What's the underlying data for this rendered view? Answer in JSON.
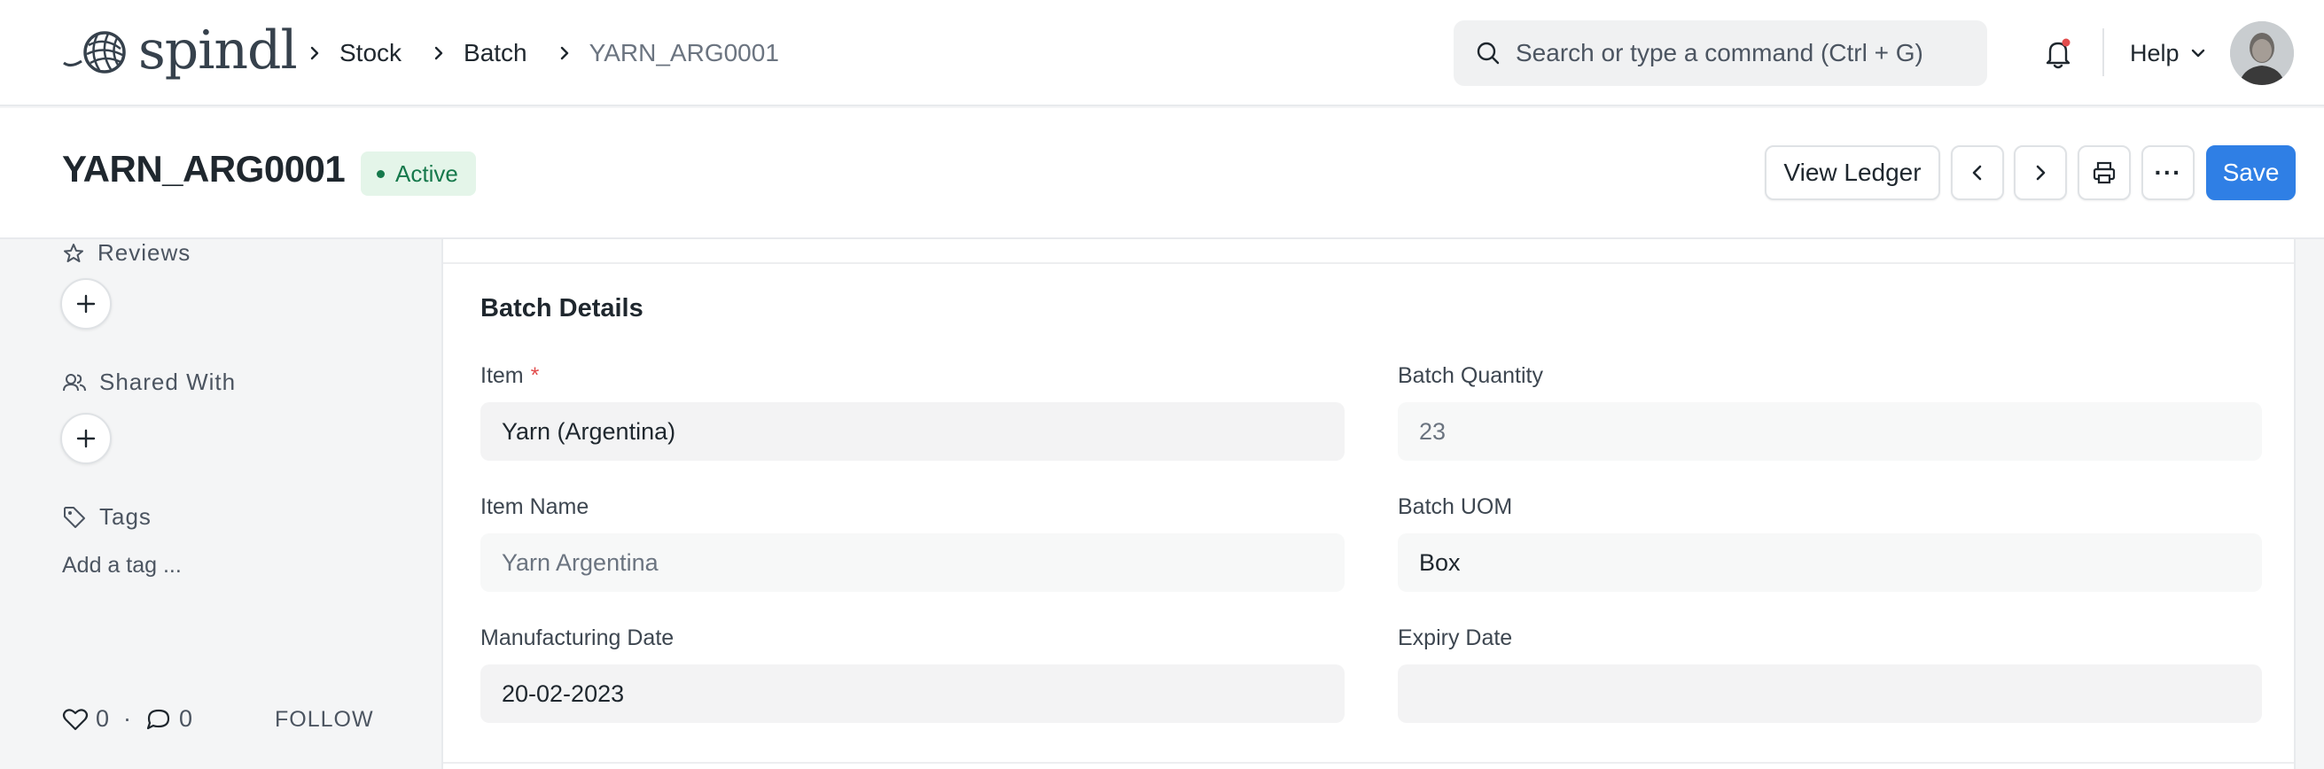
{
  "app": {
    "logo_text": "spindl"
  },
  "breadcrumb": {
    "items": [
      "Stock",
      "Batch"
    ],
    "current": "YARN_ARG0001"
  },
  "search": {
    "placeholder": "Search or type a command (Ctrl + G)"
  },
  "navbar": {
    "help_label": "Help"
  },
  "page": {
    "title": "YARN_ARG0001",
    "status": "Active",
    "view_ledger_label": "View Ledger",
    "more_label": "···",
    "save_label": "Save"
  },
  "sidebar": {
    "reviews_label": "Reviews",
    "shared_with_label": "Shared With",
    "tags_label": "Tags",
    "add_tag_label": "Add a tag ...",
    "likes_count": "0",
    "comments_count": "0",
    "follow_label": "FOLLOW"
  },
  "form": {
    "section_title": "Batch Details",
    "fields": {
      "item": {
        "label": "Item",
        "required_mark": "*",
        "value": "Yarn (Argentina)"
      },
      "batch_quantity": {
        "label": "Batch Quantity",
        "value": "23"
      },
      "item_name": {
        "label": "Item Name",
        "value": "Yarn Argentina"
      },
      "batch_uom": {
        "label": "Batch UOM",
        "value": "Box"
      },
      "manufacturing_date": {
        "label": "Manufacturing Date",
        "value": "20-02-2023"
      },
      "expiry_date": {
        "label": "Expiry Date",
        "value": ""
      }
    }
  },
  "colors": {
    "primary": "#2f7fe5",
    "status_bg": "#e4f5e9",
    "status_fg": "#16794c",
    "required": "#e24c4c"
  }
}
